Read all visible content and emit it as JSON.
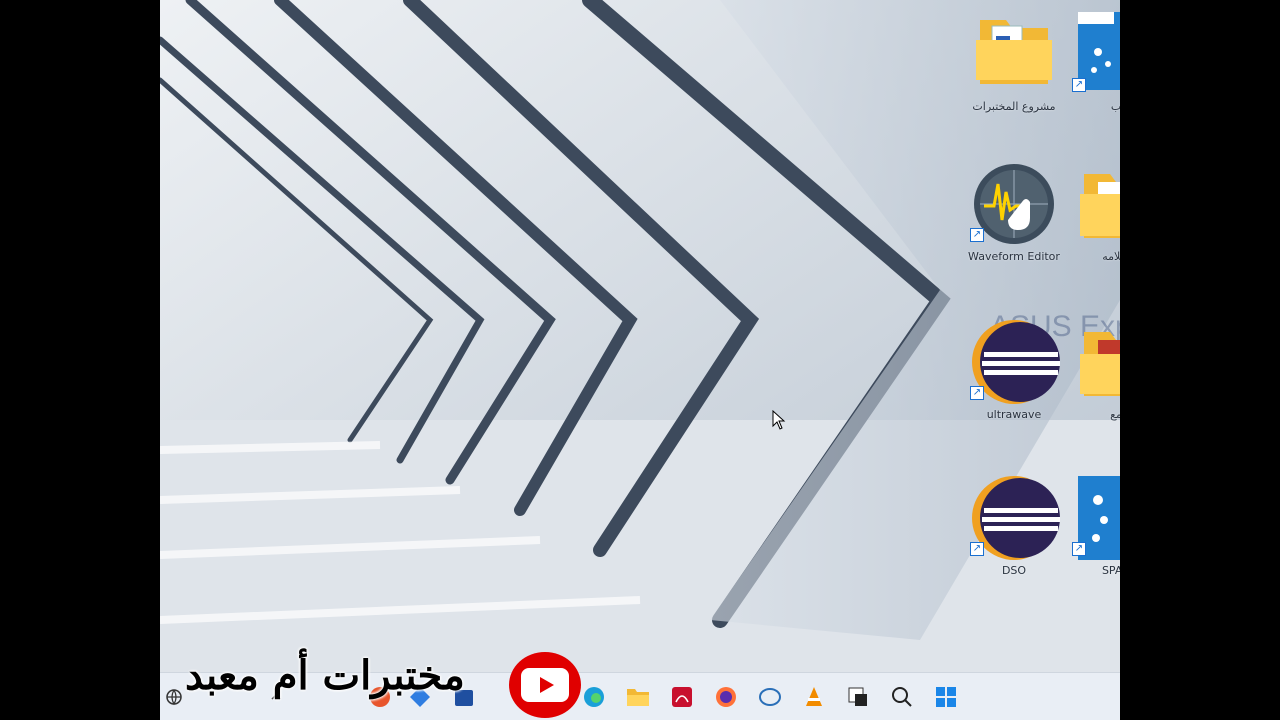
{
  "desktop": {
    "watermark": "ASUS Exp",
    "icons": [
      {
        "name": "lab-project-folder",
        "label": "مشروع المختبرات"
      },
      {
        "name": "partial-app-top",
        "label": "ب"
      },
      {
        "name": "waveform-editor",
        "label": "Waveform Editor"
      },
      {
        "name": "partial-folder-2",
        "label": "سلامه"
      },
      {
        "name": "ultrawave",
        "label": "ultrawave"
      },
      {
        "name": "partial-folder-3",
        "label": "مع"
      },
      {
        "name": "dso",
        "label": "DSO"
      },
      {
        "name": "spar",
        "label": "SPAR"
      }
    ]
  },
  "overlay": {
    "brand_text": "مختبرات أم معبد"
  },
  "taskbar": {
    "items": [
      "network",
      "up-arrow",
      "app",
      "app",
      "app",
      "edge",
      "file-explorer",
      "acrobat",
      "firefox",
      "app",
      "vlc",
      "app",
      "search",
      "start"
    ]
  },
  "colors": {
    "taskbar": "#e9eef5",
    "youtube_red": "#e00000",
    "accent": "#1a6fd0"
  }
}
